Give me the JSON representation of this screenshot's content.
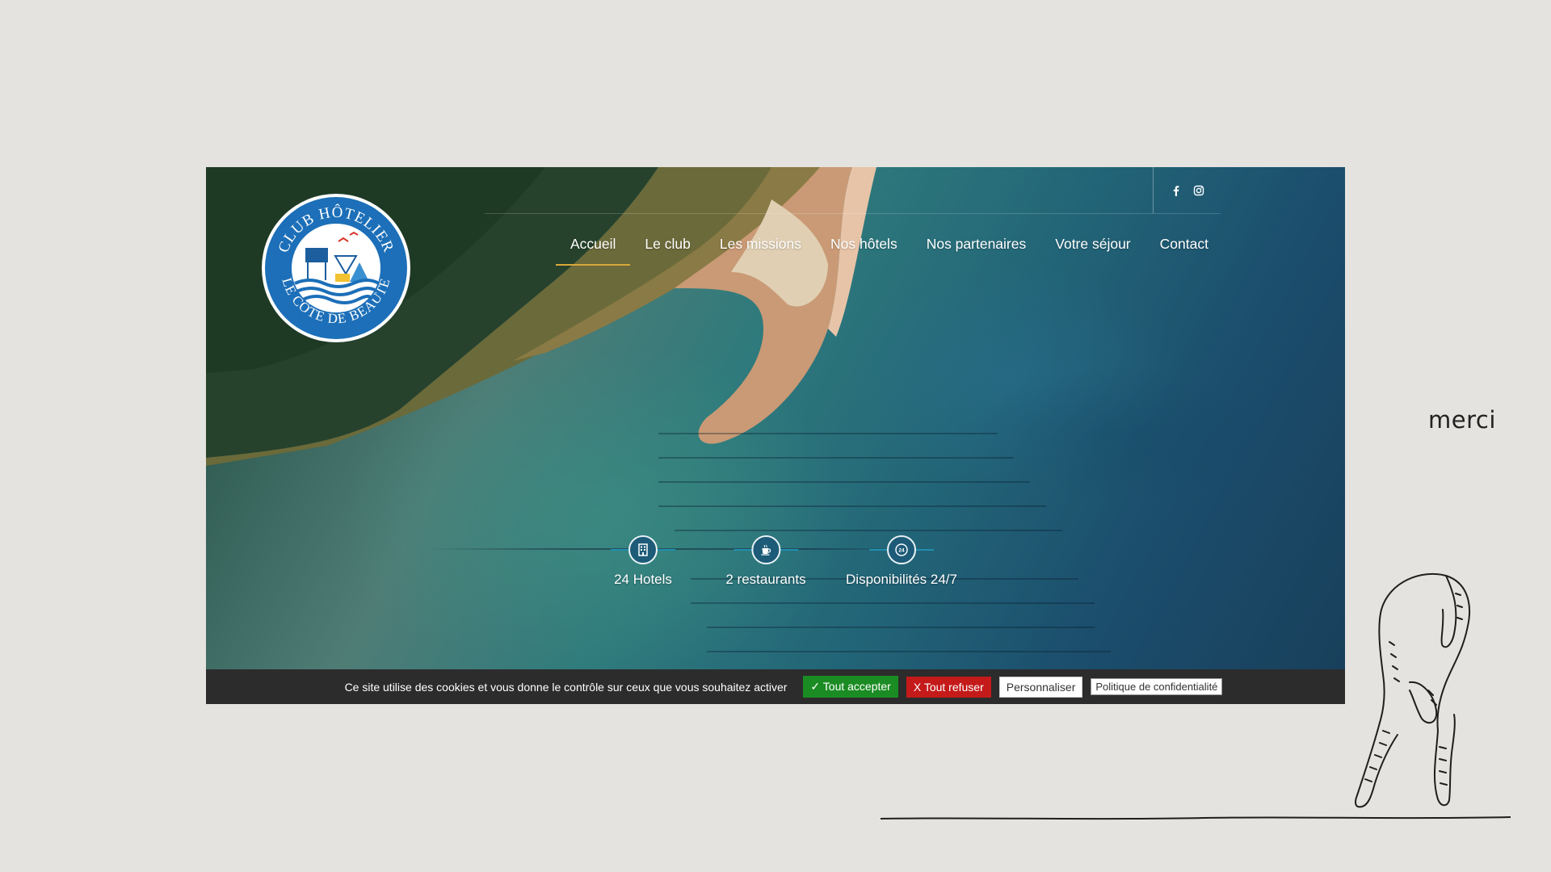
{
  "site": {
    "logo": {
      "top_text": "CLUB HÔTELIER",
      "bottom_text": "LE CÔTE DE BEAUTÉ"
    },
    "social": [
      {
        "icon": "facebook-icon"
      },
      {
        "icon": "instagram-icon"
      }
    ],
    "nav": [
      {
        "label": "Accueil",
        "active": true
      },
      {
        "label": "Le club"
      },
      {
        "label": "Les missions"
      },
      {
        "label": "Nos hôtels"
      },
      {
        "label": "Nos partenaires"
      },
      {
        "label": "Votre séjour"
      },
      {
        "label": "Contact"
      }
    ],
    "stats": [
      {
        "icon": "hotel-building-icon",
        "label": "24 Hotels"
      },
      {
        "icon": "coffee-cup-icon",
        "label": "2 restaurants"
      },
      {
        "icon": "clock-24-icon",
        "label": "Disponibilités 24/7"
      }
    ],
    "cookie": {
      "text": "Ce site utilise des cookies et vous donne le contrôle sur ceux que vous souhaitez activer",
      "accept": "✓ Tout accepter",
      "refuse": "X Tout refuser",
      "customize": "Personnaliser",
      "policy": "Politique de confidentialité"
    }
  },
  "side": {
    "merci": "merci"
  },
  "colors": {
    "background": "#e4e3df",
    "accent_underline": "#d9a83a",
    "accept_green": "#1b8c23",
    "refuse_red": "#c41a1a",
    "cookie_bar": "#2c2c2c"
  }
}
